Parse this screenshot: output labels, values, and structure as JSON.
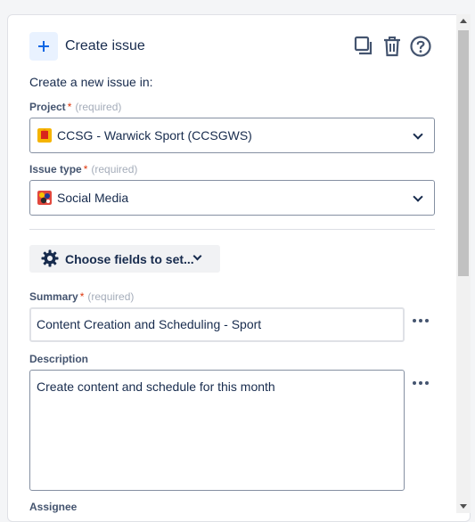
{
  "header": {
    "title": "Create issue",
    "icons": [
      "plus-icon",
      "copy-icon",
      "trash-icon",
      "help-icon"
    ]
  },
  "intro_text": "Create a new issue in:",
  "project": {
    "label": "Project",
    "required_marker": "*",
    "required_text": "(required)",
    "value": "CCSG - Warwick Sport (CCSGWS)",
    "icon": "project-avatar-icon"
  },
  "issue_type": {
    "label": "Issue type",
    "required_marker": "*",
    "required_text": "(required)",
    "value": "Social Media",
    "icon": "social-media-issue-icon"
  },
  "choose_fields": {
    "label": "Choose fields to set..."
  },
  "summary": {
    "label": "Summary",
    "required_marker": "*",
    "required_text": "(required)",
    "value": "Content Creation and Scheduling - Sport"
  },
  "description": {
    "label": "Description",
    "value": "Create content and schedule for this month"
  },
  "assignee": {
    "label": "Assignee"
  },
  "colors": {
    "accent": "#0c66e4",
    "text": "#172b4d",
    "required": "#de350b"
  }
}
